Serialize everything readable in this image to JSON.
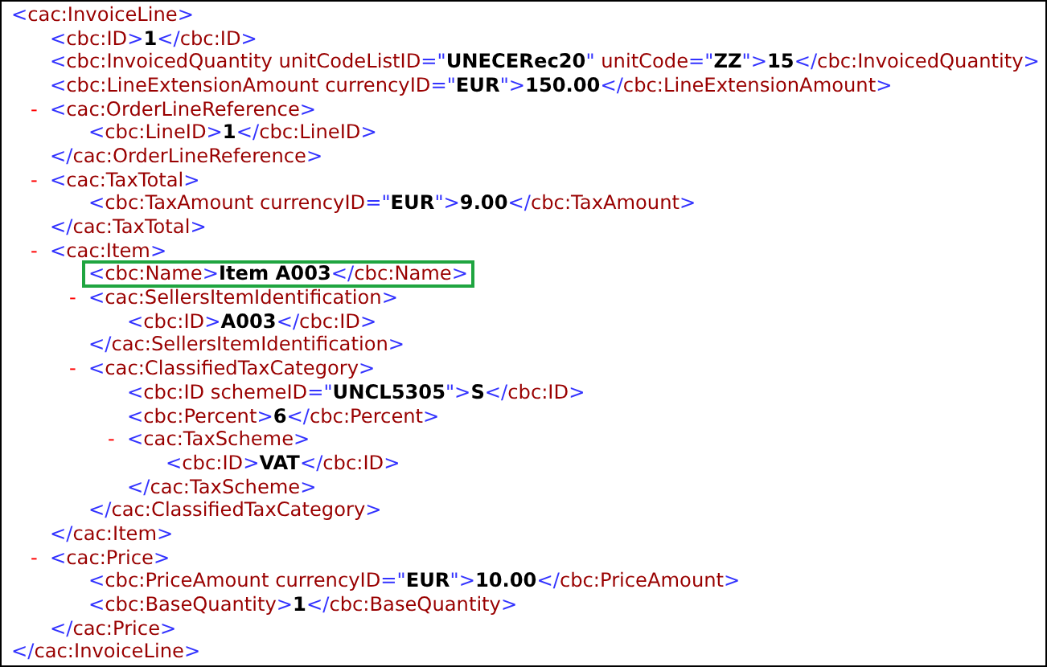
{
  "xml_tree": {
    "highlighted": false,
    "line": [
      {
        "kind": "markup",
        "text": "<"
      },
      {
        "kind": "name",
        "text": "cac:InvoiceLine"
      },
      {
        "kind": "markup",
        "text": ">"
      }
    ],
    "end_line": [
      {
        "kind": "markup",
        "text": "</"
      },
      {
        "kind": "name",
        "text": "cac:InvoiceLine"
      },
      {
        "kind": "markup",
        "text": ">"
      }
    ],
    "children": [
      {
        "highlighted": false,
        "line": [
          {
            "kind": "markup",
            "text": "<"
          },
          {
            "kind": "name",
            "text": "cbc:ID"
          },
          {
            "kind": "markup",
            "text": ">"
          },
          {
            "kind": "value",
            "text": "1"
          },
          {
            "kind": "markup",
            "text": "</"
          },
          {
            "kind": "name",
            "text": "cbc:ID"
          },
          {
            "kind": "markup",
            "text": ">"
          }
        ]
      },
      {
        "highlighted": false,
        "line": [
          {
            "kind": "markup",
            "text": "<"
          },
          {
            "kind": "name",
            "text": "cbc:InvoicedQuantity"
          },
          {
            "kind": "attribute",
            "text": " unitCodeListID"
          },
          {
            "kind": "markup",
            "text": "=\""
          },
          {
            "kind": "value",
            "text": "UNECERec20"
          },
          {
            "kind": "markup",
            "text": "\""
          },
          {
            "kind": "attribute",
            "text": " unitCode"
          },
          {
            "kind": "markup",
            "text": "=\""
          },
          {
            "kind": "value",
            "text": "ZZ"
          },
          {
            "kind": "markup",
            "text": "\">"
          },
          {
            "kind": "value",
            "text": "15"
          },
          {
            "kind": "markup",
            "text": "</"
          },
          {
            "kind": "name",
            "text": "cbc:InvoicedQuantity"
          },
          {
            "kind": "markup",
            "text": ">"
          }
        ]
      },
      {
        "highlighted": false,
        "line": [
          {
            "kind": "markup",
            "text": "<"
          },
          {
            "kind": "name",
            "text": "cbc:LineExtensionAmount"
          },
          {
            "kind": "attribute",
            "text": " currencyID"
          },
          {
            "kind": "markup",
            "text": "=\""
          },
          {
            "kind": "value",
            "text": "EUR"
          },
          {
            "kind": "markup",
            "text": "\">"
          },
          {
            "kind": "value",
            "text": "150.00"
          },
          {
            "kind": "markup",
            "text": "</"
          },
          {
            "kind": "name",
            "text": "cbc:LineExtensionAmount"
          },
          {
            "kind": "markup",
            "text": ">"
          }
        ]
      },
      {
        "toggle": "-",
        "highlighted": false,
        "line": [
          {
            "kind": "markup",
            "text": "<"
          },
          {
            "kind": "name",
            "text": "cac:OrderLineReference"
          },
          {
            "kind": "markup",
            "text": ">"
          }
        ],
        "end_line": [
          {
            "kind": "markup",
            "text": "</"
          },
          {
            "kind": "name",
            "text": "cac:OrderLineReference"
          },
          {
            "kind": "markup",
            "text": ">"
          }
        ],
        "children": [
          {
            "highlighted": false,
            "line": [
              {
                "kind": "markup",
                "text": "<"
              },
              {
                "kind": "name",
                "text": "cbc:LineID"
              },
              {
                "kind": "markup",
                "text": ">"
              },
              {
                "kind": "value",
                "text": "1"
              },
              {
                "kind": "markup",
                "text": "</"
              },
              {
                "kind": "name",
                "text": "cbc:LineID"
              },
              {
                "kind": "markup",
                "text": ">"
              }
            ]
          }
        ]
      },
      {
        "toggle": "-",
        "highlighted": false,
        "line": [
          {
            "kind": "markup",
            "text": "<"
          },
          {
            "kind": "name",
            "text": "cac:TaxTotal"
          },
          {
            "kind": "markup",
            "text": ">"
          }
        ],
        "end_line": [
          {
            "kind": "markup",
            "text": "</"
          },
          {
            "kind": "name",
            "text": "cac:TaxTotal"
          },
          {
            "kind": "markup",
            "text": ">"
          }
        ],
        "children": [
          {
            "highlighted": false,
            "line": [
              {
                "kind": "markup",
                "text": "<"
              },
              {
                "kind": "name",
                "text": "cbc:TaxAmount"
              },
              {
                "kind": "attribute",
                "text": " currencyID"
              },
              {
                "kind": "markup",
                "text": "=\""
              },
              {
                "kind": "value",
                "text": "EUR"
              },
              {
                "kind": "markup",
                "text": "\">"
              },
              {
                "kind": "value",
                "text": "9.00"
              },
              {
                "kind": "markup",
                "text": "</"
              },
              {
                "kind": "name",
                "text": "cbc:TaxAmount"
              },
              {
                "kind": "markup",
                "text": ">"
              }
            ]
          }
        ]
      },
      {
        "toggle": "-",
        "highlighted": false,
        "line": [
          {
            "kind": "markup",
            "text": "<"
          },
          {
            "kind": "name",
            "text": "cac:Item"
          },
          {
            "kind": "markup",
            "text": ">"
          }
        ],
        "end_line": [
          {
            "kind": "markup",
            "text": "</"
          },
          {
            "kind": "name",
            "text": "cac:Item"
          },
          {
            "kind": "markup",
            "text": ">"
          }
        ],
        "children": [
          {
            "highlighted": true,
            "line": [
              {
                "kind": "markup",
                "text": "<"
              },
              {
                "kind": "name",
                "text": "cbc:Name"
              },
              {
                "kind": "markup",
                "text": ">"
              },
              {
                "kind": "value",
                "text": "Item A003"
              },
              {
                "kind": "markup",
                "text": "</"
              },
              {
                "kind": "name",
                "text": "cbc:Name"
              },
              {
                "kind": "markup",
                "text": ">"
              }
            ]
          },
          {
            "toggle": "-",
            "highlighted": false,
            "line": [
              {
                "kind": "markup",
                "text": "<"
              },
              {
                "kind": "name",
                "text": "cac:SellersItemIdentification"
              },
              {
                "kind": "markup",
                "text": ">"
              }
            ],
            "end_line": [
              {
                "kind": "markup",
                "text": "</"
              },
              {
                "kind": "name",
                "text": "cac:SellersItemIdentification"
              },
              {
                "kind": "markup",
                "text": ">"
              }
            ],
            "children": [
              {
                "highlighted": false,
                "line": [
                  {
                    "kind": "markup",
                    "text": "<"
                  },
                  {
                    "kind": "name",
                    "text": "cbc:ID"
                  },
                  {
                    "kind": "markup",
                    "text": ">"
                  },
                  {
                    "kind": "value",
                    "text": "A003"
                  },
                  {
                    "kind": "markup",
                    "text": "</"
                  },
                  {
                    "kind": "name",
                    "text": "cbc:ID"
                  },
                  {
                    "kind": "markup",
                    "text": ">"
                  }
                ]
              }
            ]
          },
          {
            "toggle": "-",
            "highlighted": false,
            "line": [
              {
                "kind": "markup",
                "text": "<"
              },
              {
                "kind": "name",
                "text": "cac:ClassifiedTaxCategory"
              },
              {
                "kind": "markup",
                "text": ">"
              }
            ],
            "end_line": [
              {
                "kind": "markup",
                "text": "</"
              },
              {
                "kind": "name",
                "text": "cac:ClassifiedTaxCategory"
              },
              {
                "kind": "markup",
                "text": ">"
              }
            ],
            "children": [
              {
                "highlighted": false,
                "line": [
                  {
                    "kind": "markup",
                    "text": "<"
                  },
                  {
                    "kind": "name",
                    "text": "cbc:ID"
                  },
                  {
                    "kind": "attribute",
                    "text": " schemeID"
                  },
                  {
                    "kind": "markup",
                    "text": "=\""
                  },
                  {
                    "kind": "value",
                    "text": "UNCL5305"
                  },
                  {
                    "kind": "markup",
                    "text": "\">"
                  },
                  {
                    "kind": "value",
                    "text": "S"
                  },
                  {
                    "kind": "markup",
                    "text": "</"
                  },
                  {
                    "kind": "name",
                    "text": "cbc:ID"
                  },
                  {
                    "kind": "markup",
                    "text": ">"
                  }
                ]
              },
              {
                "highlighted": false,
                "line": [
                  {
                    "kind": "markup",
                    "text": "<"
                  },
                  {
                    "kind": "name",
                    "text": "cbc:Percent"
                  },
                  {
                    "kind": "markup",
                    "text": ">"
                  },
                  {
                    "kind": "value",
                    "text": "6"
                  },
                  {
                    "kind": "markup",
                    "text": "</"
                  },
                  {
                    "kind": "name",
                    "text": "cbc:Percent"
                  },
                  {
                    "kind": "markup",
                    "text": ">"
                  }
                ]
              },
              {
                "toggle": "-",
                "highlighted": false,
                "line": [
                  {
                    "kind": "markup",
                    "text": "<"
                  },
                  {
                    "kind": "name",
                    "text": "cac:TaxScheme"
                  },
                  {
                    "kind": "markup",
                    "text": ">"
                  }
                ],
                "end_line": [
                  {
                    "kind": "markup",
                    "text": "</"
                  },
                  {
                    "kind": "name",
                    "text": "cac:TaxScheme"
                  },
                  {
                    "kind": "markup",
                    "text": ">"
                  }
                ],
                "children": [
                  {
                    "highlighted": false,
                    "line": [
                      {
                        "kind": "markup",
                        "text": "<"
                      },
                      {
                        "kind": "name",
                        "text": "cbc:ID"
                      },
                      {
                        "kind": "markup",
                        "text": ">"
                      },
                      {
                        "kind": "value",
                        "text": "VAT"
                      },
                      {
                        "kind": "markup",
                        "text": "</"
                      },
                      {
                        "kind": "name",
                        "text": "cbc:ID"
                      },
                      {
                        "kind": "markup",
                        "text": ">"
                      }
                    ]
                  }
                ]
              }
            ]
          }
        ]
      },
      {
        "toggle": "-",
        "highlighted": false,
        "line": [
          {
            "kind": "markup",
            "text": "<"
          },
          {
            "kind": "name",
            "text": "cac:Price"
          },
          {
            "kind": "markup",
            "text": ">"
          }
        ],
        "end_line": [
          {
            "kind": "markup",
            "text": "</"
          },
          {
            "kind": "name",
            "text": "cac:Price"
          },
          {
            "kind": "markup",
            "text": ">"
          }
        ],
        "children": [
          {
            "highlighted": false,
            "line": [
              {
                "kind": "markup",
                "text": "<"
              },
              {
                "kind": "name",
                "text": "cbc:PriceAmount"
              },
              {
                "kind": "attribute",
                "text": " currencyID"
              },
              {
                "kind": "markup",
                "text": "=\""
              },
              {
                "kind": "value",
                "text": "EUR"
              },
              {
                "kind": "markup",
                "text": "\">"
              },
              {
                "kind": "value",
                "text": "10.00"
              },
              {
                "kind": "markup",
                "text": "</"
              },
              {
                "kind": "name",
                "text": "cbc:PriceAmount"
              },
              {
                "kind": "markup",
                "text": ">"
              }
            ]
          },
          {
            "highlighted": false,
            "line": [
              {
                "kind": "markup",
                "text": "<"
              },
              {
                "kind": "name",
                "text": "cbc:BaseQuantity"
              },
              {
                "kind": "markup",
                "text": ">"
              },
              {
                "kind": "value",
                "text": "1"
              },
              {
                "kind": "markup",
                "text": "</"
              },
              {
                "kind": "name",
                "text": "cbc:BaseQuantity"
              },
              {
                "kind": "markup",
                "text": ">"
              }
            ]
          }
        ]
      }
    ]
  }
}
